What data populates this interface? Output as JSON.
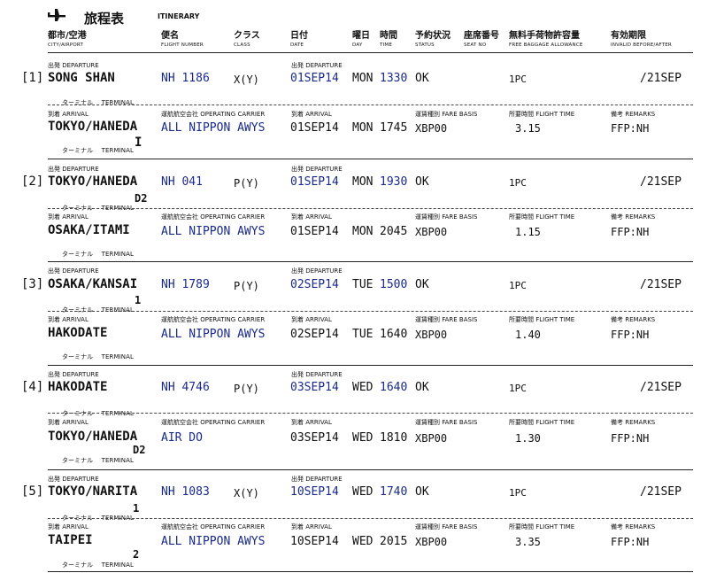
{
  "title": {
    "jp": "旅程表",
    "en": "ITINERARY",
    "icon": "airplane-icon"
  },
  "columns": [
    {
      "jp": "都市/空港",
      "en": "CITY/AIRPORT"
    },
    {
      "jp": "便名",
      "en": "FLIGHT NUMBER"
    },
    {
      "jp": "クラス",
      "en": "CLASS"
    },
    {
      "jp": "日付",
      "en": "DATE"
    },
    {
      "jp": "曜日",
      "en": "DAY"
    },
    {
      "jp": "時間",
      "en": "TIME"
    },
    {
      "jp": "予約状況",
      "en": "STATUS"
    },
    {
      "jp": "座席番号",
      "en": "SEAT NO"
    },
    {
      "jp": "無料手荷物許容量",
      "en": "FREE BAGGAGE ALLOWANCE"
    },
    {
      "jp": "有効期限",
      "en": "INVALID BEFORE/AFTER"
    }
  ],
  "labels": {
    "departure_jp": "出発",
    "departure_en": "DEPARTURE",
    "arrival_jp": "到着",
    "arrival_en": "ARRIVAL",
    "terminal_jp": "ターミナル",
    "terminal_en": "TERMINAL",
    "carrier_jp": "運航航空会社",
    "carrier_en": "OPERATING CARRIER",
    "fare_jp": "運賃種別",
    "fare_en": "FARE BASIS",
    "time_jp": "所要時間",
    "time_en": "FLIGHT TIME",
    "remarks_jp": "備考",
    "remarks_en": "REMARKS"
  },
  "segments": [
    {
      "index": "[1]",
      "from": "SONG SHAN",
      "from_terminal": "",
      "flight": "NH 1186",
      "class": "X(Y)",
      "dep_date": "01SEP14",
      "dep_day": "MON",
      "dep_time": "1330",
      "status": "OK",
      "baggage": "1PC",
      "validity": "/21SEP",
      "to": "TOKYO/HANEDA",
      "to_terminal": "I",
      "carrier": "ALL NIPPON AWYS",
      "arr_date": "01SEP14",
      "arr_day": "MON",
      "arr_time": "1745",
      "fare": "XBP00",
      "flight_time": "3.15",
      "remarks": "FFP:NH"
    },
    {
      "index": "[2]",
      "from": "TOKYO/HANEDA",
      "from_terminal": "D2",
      "flight": "NH 041",
      "class": "P(Y)",
      "dep_date": "01SEP14",
      "dep_day": "MON",
      "dep_time": "1930",
      "status": "OK",
      "baggage": "1PC",
      "validity": "/21SEP",
      "to": "OSAKA/ITAMI",
      "to_terminal": "",
      "carrier": "ALL NIPPON AWYS",
      "arr_date": "01SEP14",
      "arr_day": "MON",
      "arr_time": "2045",
      "fare": "XBP00",
      "flight_time": "1.15",
      "remarks": "FFP:NH"
    },
    {
      "index": "[3]",
      "from": "OSAKA/KANSAI",
      "from_terminal": "1",
      "flight": "NH 1789",
      "class": "P(Y)",
      "dep_date": "02SEP14",
      "dep_day": "TUE",
      "dep_time": "1500",
      "status": "OK",
      "baggage": "1PC",
      "validity": "/21SEP",
      "to": "HAKODATE",
      "to_terminal": "",
      "carrier": "ALL NIPPON AWYS",
      "arr_date": "02SEP14",
      "arr_day": "TUE",
      "arr_time": "1640",
      "fare": "XBP00",
      "flight_time": "1.40",
      "remarks": "FFP:NH"
    },
    {
      "index": "[4]",
      "from": "HAKODATE",
      "from_terminal": "",
      "flight": "NH 4746",
      "class": "P(Y)",
      "dep_date": "03SEP14",
      "dep_day": "WED",
      "dep_time": "1640",
      "status": "OK",
      "baggage": "1PC",
      "validity": "/21SEP",
      "to": "TOKYO/HANEDA",
      "to_terminal": "D2",
      "carrier": "AIR DO",
      "arr_date": "03SEP14",
      "arr_day": "WED",
      "arr_time": "1810",
      "fare": "XBP00",
      "flight_time": "1.30",
      "remarks": "FFP:NH"
    },
    {
      "index": "[5]",
      "from": "TOKYO/NARITA",
      "from_terminal": "1",
      "flight": "NH 1083",
      "class": "X(Y)",
      "dep_date": "10SEP14",
      "dep_day": "WED",
      "dep_time": "1740",
      "status": "OK",
      "baggage": "1PC",
      "validity": "/21SEP",
      "to": "TAIPEI",
      "to_terminal": "2",
      "carrier": "ALL NIPPON AWYS",
      "arr_date": "10SEP14",
      "arr_day": "WED",
      "arr_time": "2015",
      "fare": "XBP00",
      "flight_time": "3.35",
      "remarks": "FFP:NH"
    }
  ]
}
